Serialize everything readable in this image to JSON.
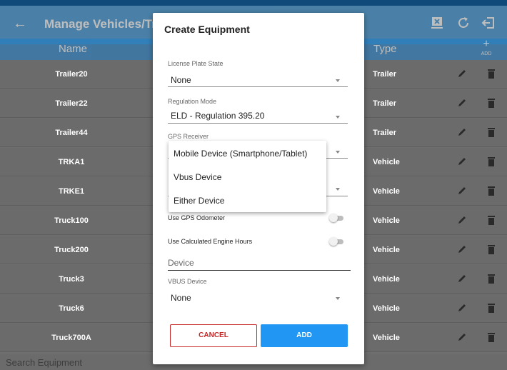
{
  "appbar": {
    "title": "Manage Vehicles/Trailers",
    "back_icon": "arrow-left-icon",
    "actions": [
      "export-icon",
      "refresh-icon",
      "logout-icon"
    ]
  },
  "table": {
    "columns": {
      "name": "Name",
      "type": "Type"
    },
    "add_label": "ADD",
    "rows": [
      {
        "name": "Trailer20",
        "type": "Trailer"
      },
      {
        "name": "Trailer22",
        "type": "Trailer"
      },
      {
        "name": "Trailer44",
        "type": "Trailer"
      },
      {
        "name": "TRKA1",
        "type": "Vehicle"
      },
      {
        "name": "TRKE1",
        "type": "Vehicle"
      },
      {
        "name": "Truck100",
        "type": "Vehicle"
      },
      {
        "name": "Truck200",
        "type": "Vehicle"
      },
      {
        "name": "Truck3",
        "type": "Vehicle"
      },
      {
        "name": "Truck6",
        "type": "Vehicle"
      },
      {
        "name": "Truck700A",
        "type": "Vehicle"
      }
    ]
  },
  "search": {
    "placeholder": "Search Equipment"
  },
  "dialog": {
    "title": "Create Equipment",
    "license_plate_state": {
      "label": "License Plate State",
      "value": "None"
    },
    "regulation_mode": {
      "label": "Regulation Mode",
      "value": "ELD - Regulation 395.20"
    },
    "gps_receiver": {
      "label": "GPS Receiver"
    },
    "use_gps_odometer": {
      "label": "Use GPS Odometer",
      "on": false
    },
    "use_calculated_engine_hours": {
      "label": "Use Calculated Engine Hours",
      "on": false
    },
    "device": {
      "placeholder": "Device"
    },
    "vbus_device": {
      "label": "VBUS Device",
      "value": "None"
    },
    "cancel_label": "CANCEL",
    "add_label": "ADD"
  },
  "gps_dropdown": {
    "options": [
      "Mobile Device (Smartphone/Tablet)",
      "Vbus Device",
      "Either Device"
    ]
  },
  "colors": {
    "appbar": "#2d8fd6",
    "header": "#1e7fc9",
    "cancel": "#c62828",
    "add": "#2196f3"
  }
}
